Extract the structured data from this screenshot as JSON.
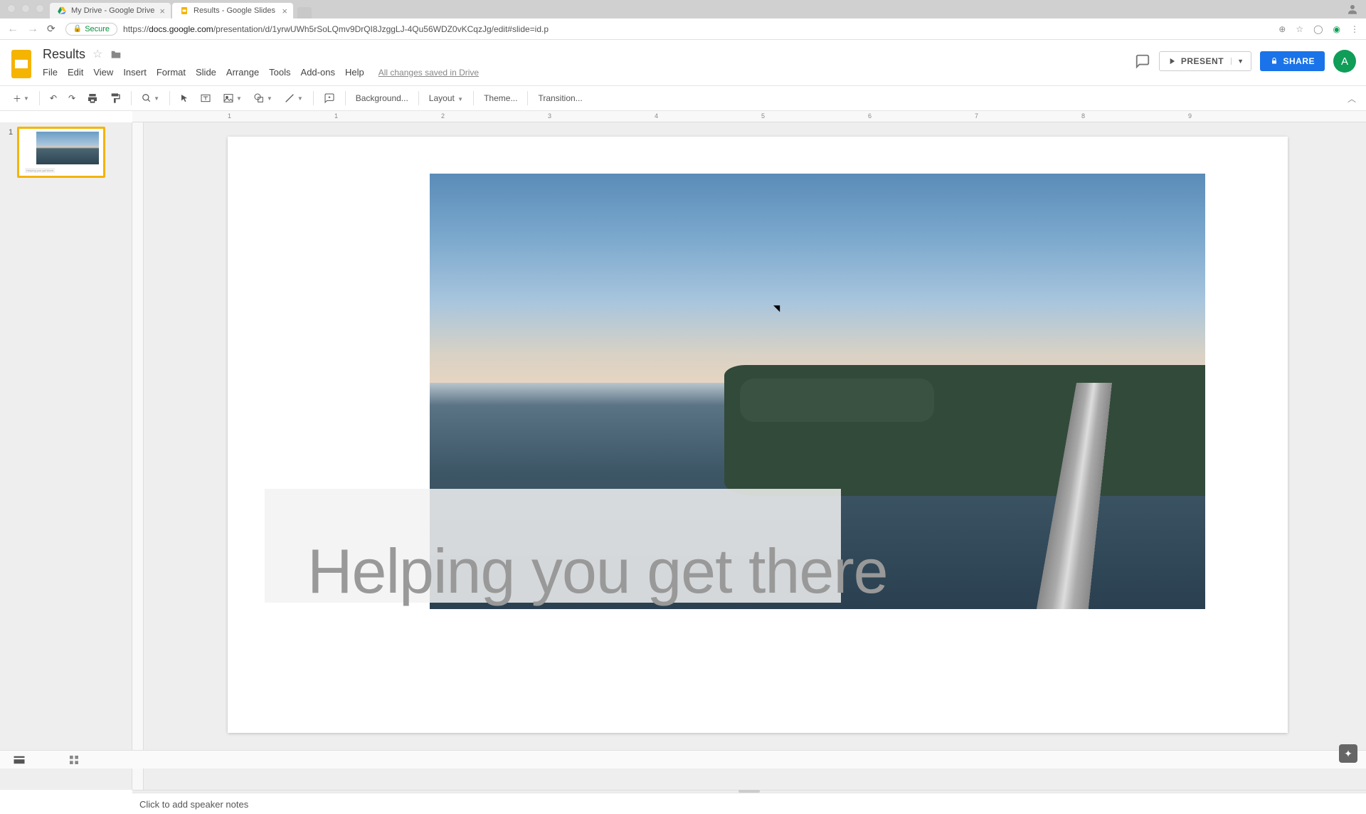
{
  "browser": {
    "tabs": [
      {
        "title": "My Drive - Google Drive"
      },
      {
        "title": "Results - Google Slides"
      }
    ],
    "secure_label": "Secure",
    "url_prefix": "https://",
    "url_domain": "docs.google.com",
    "url_path": "/presentation/d/1yrwUWh5rSoLQmv9DrQI8JzggLJ-4Qu56WDZ0vKCqzJg/edit#slide=id.p"
  },
  "doc": {
    "title": "Results",
    "save_status": "All changes saved in Drive",
    "menus": [
      "File",
      "Edit",
      "View",
      "Insert",
      "Format",
      "Slide",
      "Arrange",
      "Tools",
      "Add-ons",
      "Help"
    ],
    "present_label": "PRESENT",
    "share_label": "SHARE",
    "avatar_letter": "A"
  },
  "toolbar": {
    "background_label": "Background...",
    "layout_label": "Layout",
    "theme_label": "Theme...",
    "transition_label": "Transition..."
  },
  "ruler": {
    "marks": [
      "1",
      "",
      "1",
      "2",
      "3",
      "4",
      "5",
      "6",
      "7",
      "8",
      "9"
    ]
  },
  "filmstrip": {
    "slides": [
      {
        "num": "1"
      }
    ]
  },
  "slide": {
    "title_text": "Helping you get there"
  },
  "notes": {
    "placeholder": "Click to add speaker notes"
  }
}
